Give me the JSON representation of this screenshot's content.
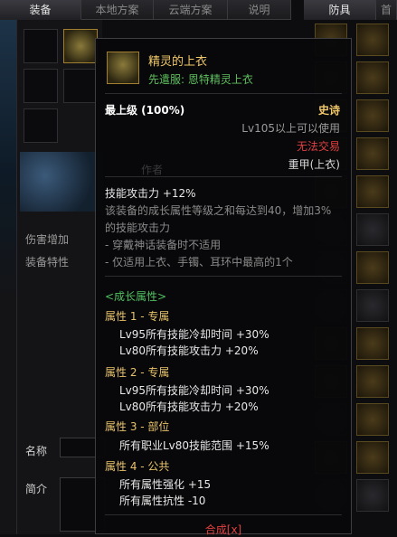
{
  "tabs": [
    "装备",
    "本地方案",
    "云端方案",
    "说明"
  ],
  "right_tabs": [
    "防具",
    "首"
  ],
  "left": {
    "damage_label": "伤害增加",
    "trait_label": "装备特性",
    "name_label": "名称",
    "desc_label": "简介",
    "bg_text": "作者"
  },
  "tooltip": {
    "item_name": "精灵的上衣",
    "item_subtitle": "先遣服: 恩特精灵上衣",
    "grade": "最上级 (100%)",
    "rarity": "史诗",
    "level_req": "Lv105以上可以使用",
    "trade": "无法交易",
    "slot_type": "重甲(上衣)",
    "skill_attack": "技能攻击力  +12%",
    "desc_lines": [
      "该装备的成长属性等级之和每达到40，增加3%",
      "的技能攻击力",
      "- 穿戴神话装备时不适用",
      "- 仅适用上衣、手镯、耳环中最高的1个"
    ],
    "growth_header": "<成长属性>",
    "attributes": [
      {
        "title": "属性 1 - 专属",
        "lines": [
          "Lv95所有技能冷却时间 +30%",
          "Lv80所有技能攻击力 +20%"
        ]
      },
      {
        "title": "属性 2 - 专属",
        "lines": [
          "Lv95所有技能冷却时间 +30%",
          "Lv80所有技能攻击力 +20%"
        ]
      },
      {
        "title": "属性 3 - 部位",
        "lines": [
          "所有职业Lv80技能范围 +15%"
        ]
      },
      {
        "title": "属性 4 - 公共",
        "lines": [
          "所有属性强化 +15",
          "所有属性抗性 -10"
        ]
      }
    ],
    "footer": "合成[x]"
  },
  "colors": {
    "item_name": "#f2c96a",
    "subtitle": "#5fbf5f",
    "rarity": "#f2c96a",
    "trade": "#e04040",
    "attr_title": "#e8c26a",
    "growth": "#50c060",
    "footer": "#e04040"
  }
}
